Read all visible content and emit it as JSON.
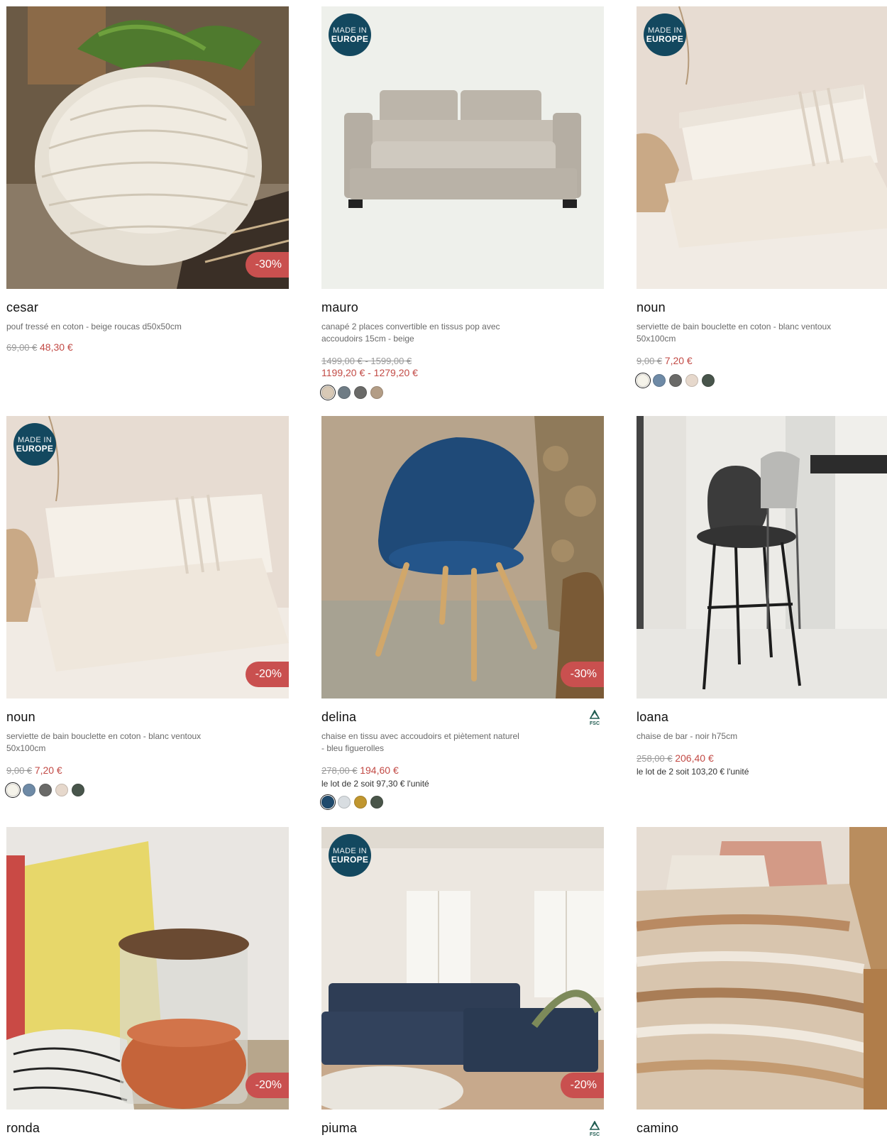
{
  "products": [
    {
      "name": "cesar",
      "description": "pouf tressé en coton - beige roucas d50x50cm",
      "old_price": "69,00 €",
      "new_price": "48,30 €",
      "discount": "-30%"
    },
    {
      "name": "mauro",
      "description": "canapé 2 places convertible en tissus pop avec accoudoirs 15cm - beige",
      "old_price": "1499,00 € - 1599,00 €",
      "new_price": "1199,20 € - 1279,20 €",
      "badge_line1": "MADE IN",
      "badge_line2": "EUROPE",
      "swatches": [
        "#d8c9b6",
        "#6f7c85",
        "#6a6a68",
        "#b39d86"
      ]
    },
    {
      "name": "noun",
      "description": "serviette de bain bouclette en coton - blanc ventoux 50x100cm",
      "old_price": "9,00 €",
      "new_price": "7,20 €",
      "badge_line1": "MADE IN",
      "badge_line2": "EUROPE",
      "swatches": [
        "#f5f3ea",
        "#6e8aa6",
        "#6a6a68",
        "#e6d8cc",
        "#48554b"
      ]
    },
    {
      "name": "noun",
      "description": "serviette de bain bouclette en coton - blanc ventoux 50x100cm",
      "old_price": "9,00 €",
      "new_price": "7,20 €",
      "discount": "-20%",
      "badge_line1": "MADE IN",
      "badge_line2": "EUROPE",
      "swatches": [
        "#f5f3ea",
        "#6e8aa6",
        "#6a6a68",
        "#e6d8cc",
        "#48554b"
      ]
    },
    {
      "name": "delina",
      "description": "chaise en tissu avec accoudoirs et piètement naturel - bleu figuerolles",
      "old_price": "278,00 €",
      "new_price": "194,60 €",
      "lot": "le lot de 2 soit 97,30 € l'unité",
      "discount": "-30%",
      "fsc": "FSC",
      "swatches": [
        "#1f4a6c",
        "#d8dde1",
        "#c0962f",
        "#4a564a"
      ]
    },
    {
      "name": "loana",
      "description": "chaise de bar - noir h75cm",
      "old_price": "258,00 €",
      "new_price": "206,40 €",
      "lot": "le lot de 2 soit 103,20 € l'unité"
    },
    {
      "name": "ronda",
      "discount": "-20%"
    },
    {
      "name": "piuma",
      "discount": "-20%",
      "badge_line1": "MADE IN",
      "badge_line2": "EUROPE",
      "fsc": "FSC"
    },
    {
      "name": "camino"
    }
  ],
  "colors": {
    "accent_red": "#c9504f",
    "badge_blue": "#13485f"
  }
}
